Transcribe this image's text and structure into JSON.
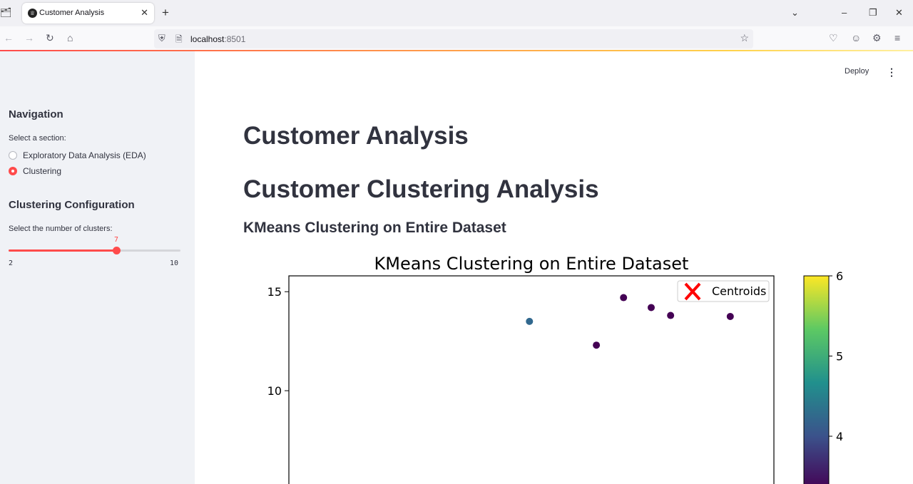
{
  "browser": {
    "tab_title": "Customer Analysis",
    "url_host": "localhost",
    "url_port": ":8501"
  },
  "header": {
    "deploy_label": "Deploy"
  },
  "sidebar": {
    "navigation_heading": "Navigation",
    "section_label": "Select a section:",
    "sections": [
      {
        "label": "Exploratory Data Analysis (EDA)",
        "selected": false
      },
      {
        "label": "Clustering",
        "selected": true
      }
    ],
    "config_heading": "Clustering Configuration",
    "clusters_label": "Select the number of clusters:",
    "slider": {
      "min": 2,
      "max": 10,
      "value": 7,
      "min_label": "2",
      "max_label": "10",
      "value_label": "7"
    }
  },
  "main": {
    "title": "Customer Analysis",
    "subtitle": "Customer Clustering Analysis",
    "section_heading": "KMeans Clustering on Entire Dataset"
  },
  "chart_data": {
    "type": "scatter",
    "title": "KMeans Clustering on Entire Dataset",
    "xlabel": "",
    "ylabel": "",
    "y_ticks": [
      {
        "value": 15,
        "label": "15"
      },
      {
        "value": 10,
        "label": "10"
      }
    ],
    "ylim_visible": [
      5.0,
      15.8
    ],
    "xlim": [
      0,
      1
    ],
    "points": [
      {
        "x": 0.496,
        "y": 13.5,
        "cluster": 1
      },
      {
        "x": 0.634,
        "y": 12.3,
        "cluster": 0
      },
      {
        "x": 0.69,
        "y": 14.7,
        "cluster": 0
      },
      {
        "x": 0.747,
        "y": 14.2,
        "cluster": 0
      },
      {
        "x": 0.787,
        "y": 13.8,
        "cluster": 0
      },
      {
        "x": 0.91,
        "y": 13.75,
        "cluster": 0
      }
    ],
    "legend": {
      "label": "Centroids",
      "placement": "top-right",
      "marker_color": "#ff0000"
    },
    "colorbar": {
      "ticks": [
        {
          "value": 6,
          "label": "6"
        },
        {
          "value": 5,
          "label": "5"
        },
        {
          "value": 4,
          "label": "4"
        }
      ],
      "range": [
        0,
        6
      ],
      "colormap": "viridis"
    },
    "cluster_colors": {
      "0": "#440154",
      "1": "#31688e"
    }
  }
}
